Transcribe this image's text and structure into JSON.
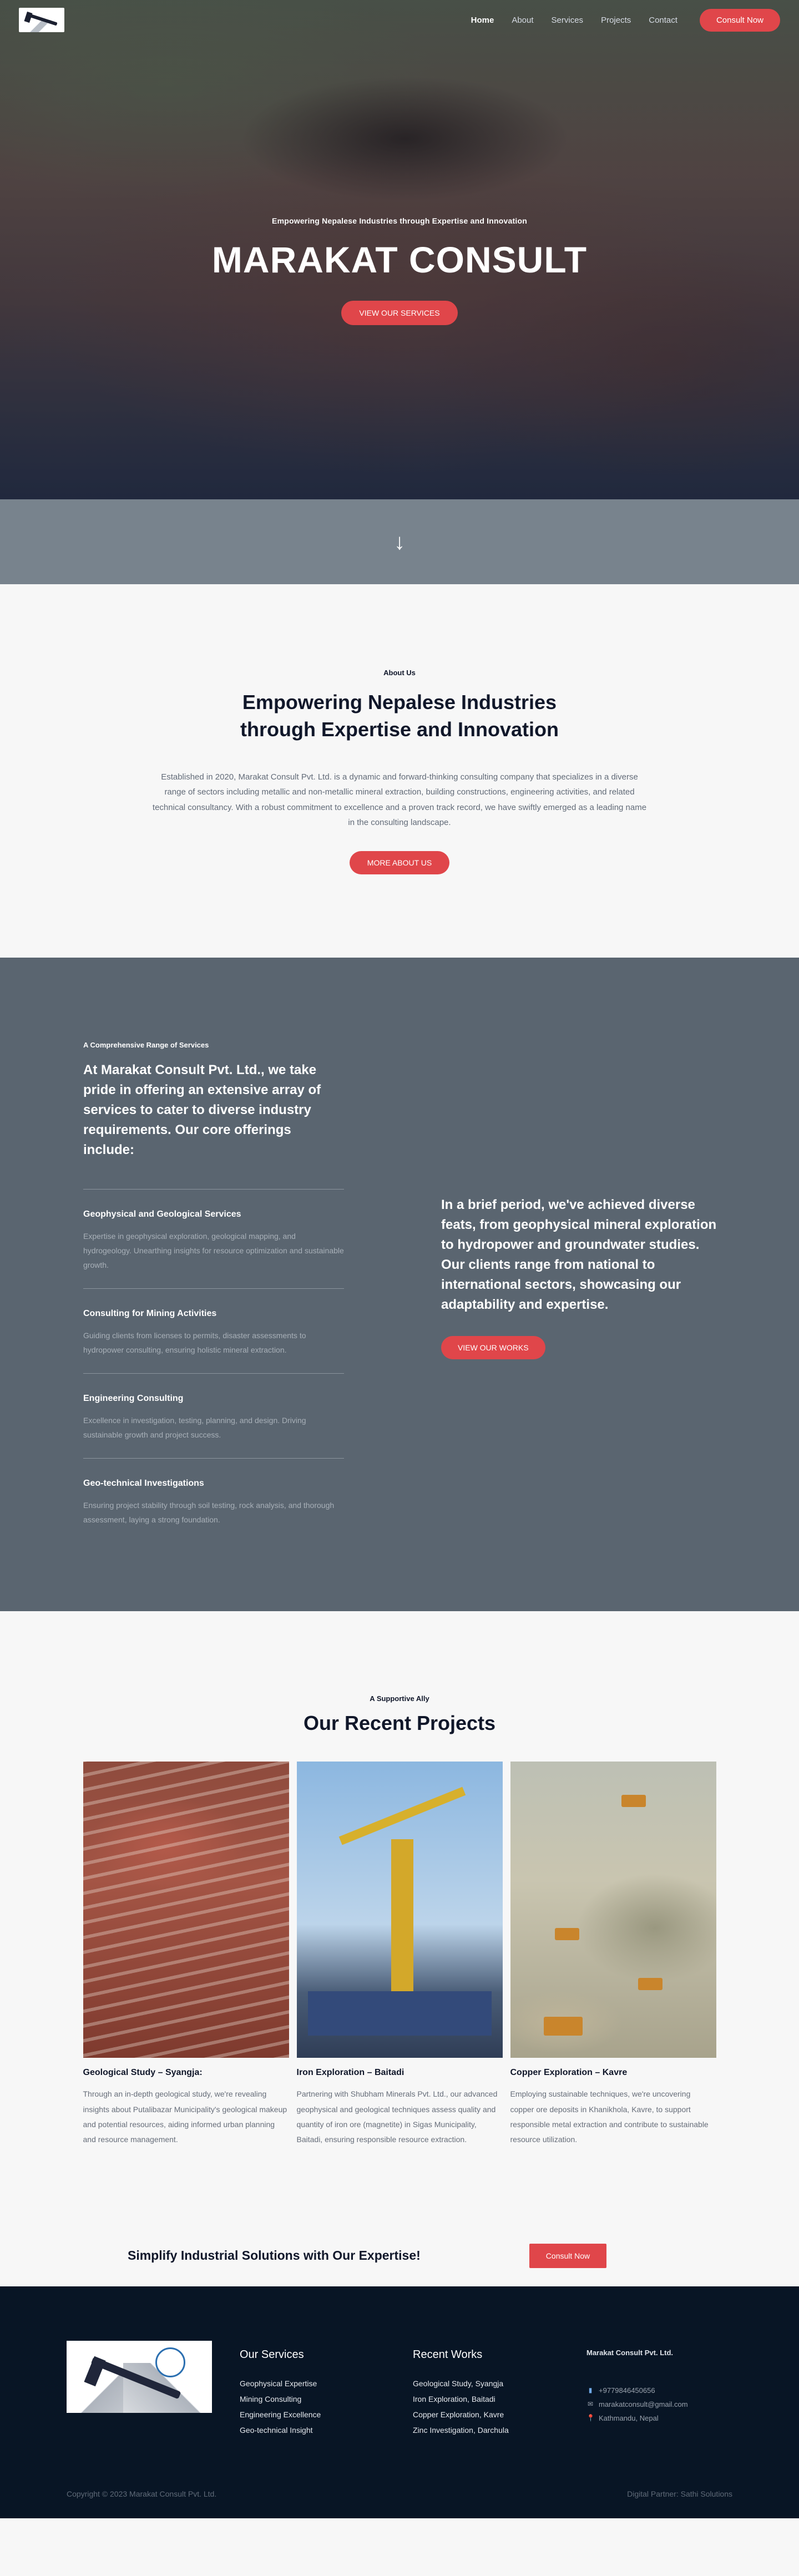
{
  "nav": {
    "logo_alt": "Marakat Consult logo",
    "links": [
      {
        "label": "Home",
        "active": true
      },
      {
        "label": "About",
        "active": false
      },
      {
        "label": "Services",
        "active": false
      },
      {
        "label": "Projects",
        "active": false
      },
      {
        "label": "Contact",
        "active": false
      }
    ],
    "cta_label": "Consult Now"
  },
  "hero": {
    "subtitle": "Empowering Nepalese Industries through Expertise and Innovation",
    "title": "MARAKAT CONSULT",
    "button_label": "VIEW OUR SERVICES",
    "scroll_icon": "arrow-down-icon",
    "scroll_glyph": "↓"
  },
  "about": {
    "kicker": "About Us",
    "heading_line1": "Empowering Nepalese Industries",
    "heading_line2": "through Expertise and Innovation",
    "body": "Established in 2020, Marakat Consult Pvt. Ltd. is a dynamic and forward-thinking consulting company that specializes in a diverse range of sectors including metallic and non-metallic mineral extraction, building constructions, engineering activities, and related technical consultancy. With a robust commitment to excellence and a proven track record, we have swiftly emerged as a leading name in the consulting landscape.",
    "button_label": "MORE ABOUT US"
  },
  "services": {
    "kicker": "A Comprehensive Range of Services",
    "heading": "At Marakat Consult Pvt. Ltd., we take pride in offering an extensive array of services to cater to diverse industry requirements. Our core offerings include:",
    "items": [
      {
        "title": "Geophysical and Geological Services",
        "desc": "Expertise in geophysical exploration, geological mapping, and hydrogeology. Unearthing insights for resource optimization and sustainable growth."
      },
      {
        "title": "Consulting for Mining Activities",
        "desc": "Guiding clients from licenses to permits, disaster assessments to hydropower consulting, ensuring holistic mineral extraction."
      },
      {
        "title": "Engineering Consulting",
        "desc": "Excellence in investigation, testing, planning, and design. Driving sustainable growth and project success."
      },
      {
        "title": "Geo-technical Investigations",
        "desc": "Ensuring project stability through soil testing, rock analysis, and thorough assessment, laying a strong foundation."
      }
    ],
    "right_heading": "In a brief period, we've achieved diverse feats, from geophysical mineral exploration to hydropower and groundwater studies. Our clients range from national to international sectors, showcasing our adaptability and expertise.",
    "right_button": "VIEW OUR WORKS"
  },
  "projects": {
    "kicker": "A Supportive Ally",
    "heading": "Our Recent Projects",
    "items": [
      {
        "title": "Geological Study – Syangja:",
        "desc": "Through an in-depth geological study, we're revealing insights about Putalibazar Municipality's geological makeup and potential resources, aiding informed urban planning and resource management."
      },
      {
        "title": "Iron Exploration – Baitadi",
        "desc": "Partnering with Shubham Minerals Pvt. Ltd., our advanced geophysical and geological techniques assess quality and quantity of iron ore (magnetite) in Sigas Municipality, Baitadi, ensuring responsible resource extraction."
      },
      {
        "title": "Copper Exploration – Kavre",
        "desc": "Employing sustainable techniques, we're uncovering copper ore deposits in Khanikhola, Kavre, to support responsible metal extraction and contribute to sustainable resource utilization."
      }
    ]
  },
  "cta": {
    "text": "Simplify Industrial Solutions with Our Expertise!",
    "button_label": "Consult Now"
  },
  "footer": {
    "services_title": "Our Services",
    "services": [
      "Geophysical Expertise",
      "Mining Consulting",
      "Engineering Excellence",
      "Geo-technical Insight"
    ],
    "works_title": "Recent Works",
    "works": [
      "Geological Study, Syangja",
      "Iron Exploration, Baitadi",
      "Copper Exploration, Kavre",
      "Zinc Investigation, Darchula"
    ],
    "company": "Marakat Consult Pvt. Ltd.",
    "phone": "+9779846450656",
    "email": "marakatconsult@gmail.com",
    "address": "Kathmandu, Nepal",
    "copyright": "Copyright © 2023 Marakat Consult Pvt. Ltd.",
    "partner": "Digital Partner: Sathi Solutions"
  },
  "colors": {
    "accent": "#e0464a",
    "services_bg": "#5a6570",
    "footer_bg": "#081525",
    "arrow_band": "#78838d"
  }
}
